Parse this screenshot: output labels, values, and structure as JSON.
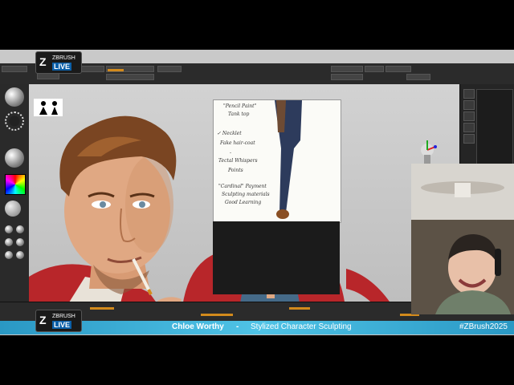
{
  "banner": {
    "name": "Chloe Worthy",
    "separator": "-",
    "topic": "Stylized Character Sculpting",
    "hashtag": "#ZBrush2025"
  },
  "logo": {
    "brand": "ZBRUSH",
    "live": "LIVE"
  },
  "sketch_notes": {
    "line1": "\"Pencil Paint\"",
    "line2": "Tank top",
    "line3": "✓ Necklet",
    "line4": "Fake hair-coat",
    "line5": "-",
    "line6": "Tectal Whispers",
    "line7": "Points",
    "line8": "\"Cardinal\" Payment",
    "line9": "Sculpting materials",
    "line10": "Good Learning"
  },
  "colors": {
    "banner": "#4fc3e6",
    "ui_dark": "#2b2b2b",
    "accent_orange": "#d28a1c",
    "canvas": "#c9c9c9",
    "jacket": "#b8262a"
  },
  "icons": {
    "logo": "zbrush-z-icon",
    "gizmo": "navigation-gizmo-icon",
    "figure": "character-figure-icon"
  }
}
